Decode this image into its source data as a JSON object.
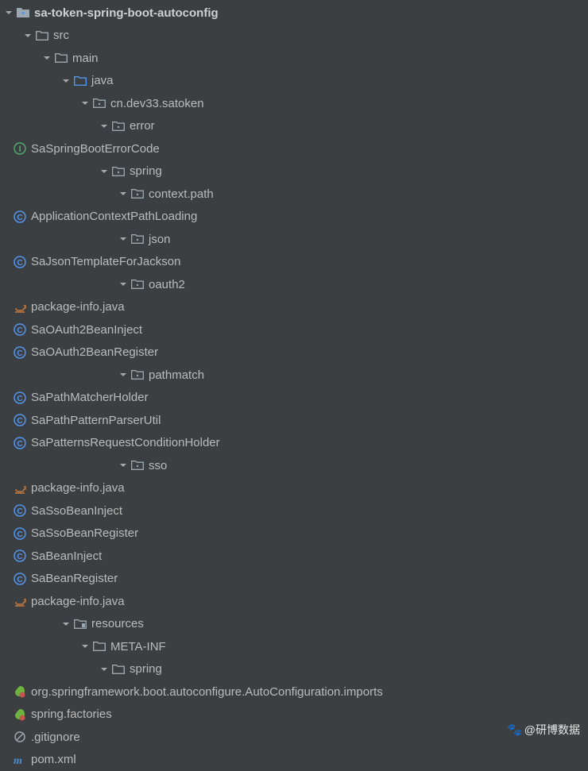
{
  "tree": {
    "root": "sa-token-spring-boot-autoconfig",
    "src": "src",
    "main": "main",
    "java": "java",
    "package": "cn.dev33.satoken",
    "error": {
      "name": "error",
      "items": [
        "SaSpringBootErrorCode"
      ]
    },
    "spring": {
      "name": "spring",
      "contextPath": {
        "name": "context.path",
        "items": [
          "ApplicationContextPathLoading"
        ]
      },
      "json": {
        "name": "json",
        "items": [
          "SaJsonTemplateForJackson"
        ]
      },
      "oauth2": {
        "name": "oauth2",
        "packageInfo": "package-info.java",
        "items": [
          "SaOAuth2BeanInject",
          "SaOAuth2BeanRegister"
        ]
      },
      "pathmatch": {
        "name": "pathmatch",
        "items": [
          "SaPathMatcherHolder",
          "SaPathPatternParserUtil",
          "SaPatternsRequestConditionHolder"
        ]
      },
      "sso": {
        "name": "sso",
        "packageInfo": "package-info.java",
        "items": [
          "SaSsoBeanInject",
          "SaSsoBeanRegister"
        ]
      },
      "classes": [
        "SaBeanInject",
        "SaBeanRegister"
      ]
    },
    "packageInfo": "package-info.java",
    "resources": "resources",
    "metaInf": "META-INF",
    "resourceSpring": "spring",
    "autoConfigImports": "org.springframework.boot.autoconfigure.AutoConfiguration.imports",
    "springFactories": "spring.factories",
    "gitignore": ".gitignore",
    "pom": "pom.xml"
  },
  "watermark": "@研博数据"
}
